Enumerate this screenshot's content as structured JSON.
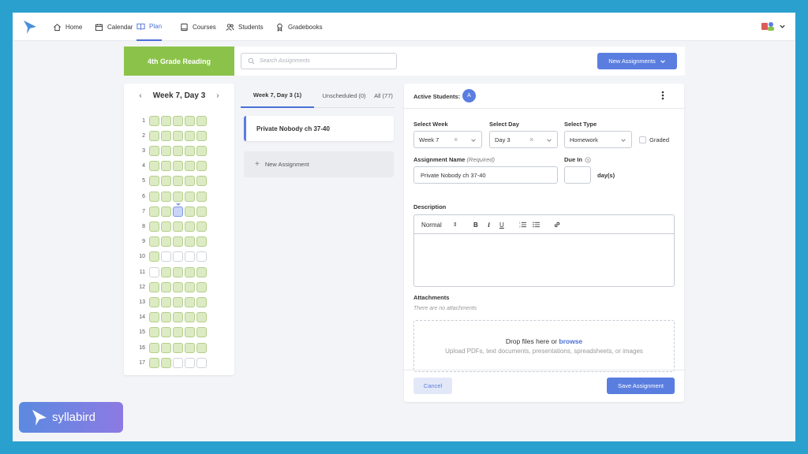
{
  "nav": {
    "items": [
      {
        "label": "Home",
        "icon": "home-icon"
      },
      {
        "label": "Calendar",
        "icon": "calendar-icon"
      },
      {
        "label": "Plan",
        "icon": "book-icon",
        "active": true
      },
      {
        "label": "Courses",
        "icon": "courses-icon"
      },
      {
        "label": "Students",
        "icon": "students-icon"
      },
      {
        "label": "Gradebooks",
        "icon": "award-icon"
      }
    ]
  },
  "course": {
    "name": "4th Grade Reading"
  },
  "search": {
    "placeholder": "Search Assignments"
  },
  "new_assignments_label": "New Assignments",
  "calendar": {
    "title": "Week 7, Day 3",
    "selected": {
      "week": 7,
      "day": 3
    },
    "weeks": [
      {
        "week": "1",
        "days": [
          1,
          1,
          1,
          1,
          1
        ]
      },
      {
        "week": "2",
        "days": [
          1,
          1,
          1,
          1,
          1
        ]
      },
      {
        "week": "3",
        "days": [
          1,
          1,
          1,
          1,
          1
        ]
      },
      {
        "week": "4",
        "days": [
          1,
          1,
          1,
          1,
          1
        ]
      },
      {
        "week": "5",
        "days": [
          1,
          1,
          1,
          1,
          1
        ]
      },
      {
        "week": "6",
        "days": [
          1,
          1,
          1,
          1,
          1
        ]
      },
      {
        "week": "7",
        "days": [
          1,
          1,
          2,
          1,
          1
        ]
      },
      {
        "week": "8",
        "days": [
          1,
          1,
          1,
          1,
          1
        ]
      },
      {
        "week": "9",
        "days": [
          1,
          1,
          1,
          1,
          1
        ]
      },
      {
        "week": "10",
        "days": [
          1,
          0,
          0,
          0,
          0
        ]
      },
      {
        "week": "11",
        "days": [
          0,
          1,
          1,
          1,
          1
        ]
      },
      {
        "week": "12",
        "days": [
          1,
          1,
          1,
          1,
          1
        ]
      },
      {
        "week": "13",
        "days": [
          1,
          1,
          1,
          1,
          1
        ]
      },
      {
        "week": "14",
        "days": [
          1,
          1,
          1,
          1,
          1
        ]
      },
      {
        "week": "15",
        "days": [
          1,
          1,
          1,
          1,
          1
        ]
      },
      {
        "week": "16",
        "days": [
          1,
          1,
          1,
          1,
          1
        ]
      },
      {
        "week": "17",
        "days": [
          1,
          1,
          0,
          0,
          0
        ]
      }
    ]
  },
  "tabs": [
    {
      "label": "Week 7, Day 3 (1)",
      "active": true
    },
    {
      "label": "Unscheduled (0)"
    },
    {
      "label": "All (77)"
    }
  ],
  "assignments": [
    {
      "title": "Private Nobody ch 37-40"
    }
  ],
  "new_assignment_label": "New Assignment",
  "form": {
    "active_students_label": "Active Students:",
    "avatar_initial": "A",
    "select_week_label": "Select Week",
    "select_week_value": "Week 7",
    "select_day_label": "Select Day",
    "select_day_value": "Day 3",
    "select_type_label": "Select Type",
    "select_type_value": "Homework",
    "graded_label": "Graded",
    "assignment_name_label": "Assignment Name",
    "assignment_name_required": "(Required)",
    "assignment_name_value": "Private Nobody ch 37-40",
    "due_in_label": "Due In",
    "due_in_suffix": "day(s)",
    "description_label": "Description",
    "editor_format": "Normal",
    "attachments_label": "Attachments",
    "no_attachments": "There are no attachments",
    "drop_text": "Drop files here or",
    "browse": "browse",
    "upload_hint": "Upload PDFs, text documents, presentations, spreadsheets, or images",
    "cancel_label": "Cancel",
    "save_label": "Save Assignment"
  },
  "brand": {
    "name": "syllabird"
  },
  "colors": {
    "accent": "#5a7ee0",
    "course": "#8bc34a",
    "background": "#2aa0cf"
  }
}
